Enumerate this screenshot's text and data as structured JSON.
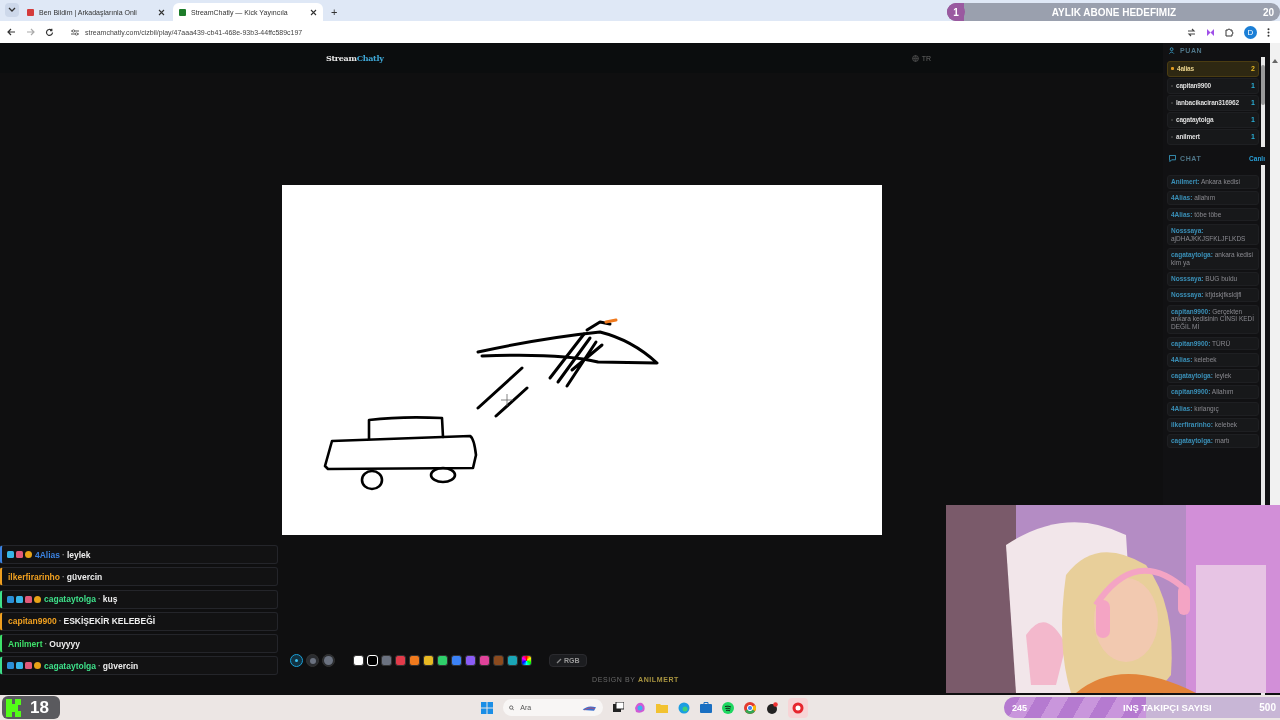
{
  "browser": {
    "tabs": [
      {
        "title": "Ben Bildim | Arkadaşlarınla Onli",
        "selected": false
      },
      {
        "title": "StreamChatly — Kick Yayıncıla",
        "selected": true
      }
    ],
    "new_tab": "+",
    "url": "streamchatly.com/cizbil/play/47aaa439-cb41-468e-93b3-44ffc589c197",
    "profile": "D"
  },
  "goal_overlay": {
    "current": "1",
    "title": "AYLIK ABONE HEDEFIMIZ",
    "target": "20",
    "level": 0.05
  },
  "header": {
    "logo_first": "Stream",
    "logo_second": "Chatly",
    "language": "TR"
  },
  "toolbar": {
    "brush_sizes": [
      {
        "selected": true
      },
      {
        "selected": false
      },
      {
        "selected": false
      }
    ],
    "colors": [
      {
        "kind": "solid",
        "color": "#ffffff",
        "selected": false
      },
      {
        "kind": "solid",
        "color": "#000000",
        "selected": true
      },
      {
        "kind": "solid",
        "color": "#6b7280",
        "selected": false
      },
      {
        "kind": "solid",
        "color": "#e23b4a",
        "selected": false
      },
      {
        "kind": "solid",
        "color": "#f07a1e",
        "selected": false
      },
      {
        "kind": "solid",
        "color": "#e8b923",
        "selected": false
      },
      {
        "kind": "solid",
        "color": "#2fcf6b",
        "selected": false
      },
      {
        "kind": "solid",
        "color": "#3b82f6",
        "selected": false
      },
      {
        "kind": "solid",
        "color": "#8b5cf6",
        "selected": false
      },
      {
        "kind": "solid",
        "color": "#e0439a",
        "selected": false
      },
      {
        "kind": "solid",
        "color": "#8b4a1e",
        "selected": false
      },
      {
        "kind": "solid",
        "color": "#1aa6b7",
        "selected": false
      },
      {
        "kind": "rainbow",
        "selected": false
      }
    ],
    "rgb_button": "RGB"
  },
  "footer": {
    "prefix": "DESIGN BY",
    "author": "ANILMERT"
  },
  "scoreboard": {
    "title": "PUAN",
    "players": [
      {
        "name": "4alias",
        "score": "2",
        "leader": true
      },
      {
        "name": "capitan9900",
        "score": "1",
        "leader": false
      },
      {
        "name": "lanbacikaciran316962",
        "score": "1",
        "leader": false
      },
      {
        "name": "cagataytolga",
        "score": "1",
        "leader": false
      },
      {
        "name": "anilmert",
        "score": "1",
        "leader": false
      }
    ]
  },
  "chat": {
    "title": "CHAT",
    "status": "Canlı",
    "messages": [
      {
        "user": "Anilmert:",
        "text": "Ankara kedisi"
      },
      {
        "user": "4Alias:",
        "text": "allahım"
      },
      {
        "user": "4Alias:",
        "text": "töbe töbe"
      },
      {
        "user": "Nosssaya:",
        "text": "ajDHAJKKJSFKLJFLKDS"
      },
      {
        "user": "cagataytolga:",
        "text": "ankara kedisi kim ya"
      },
      {
        "user": "Nosssaya:",
        "text": "BUG buldu"
      },
      {
        "user": "Nosssaya:",
        "text": "kfjdskjfksldjfl"
      },
      {
        "user": "capitan9900:",
        "text": "Gerçekten ankara kedisinin CİNSİ KEDİ DEĞİL Mİ"
      },
      {
        "user": "capitan9900:",
        "text": "TÜRÜ"
      },
      {
        "user": "4Alias:",
        "text": "kelebek"
      },
      {
        "user": "cagataytolga:",
        "text": "leylek"
      },
      {
        "user": "capitan9900:",
        "text": "Allahım"
      },
      {
        "user": "4Alias:",
        "text": "kırlangıç"
      },
      {
        "user": "ilkerfirarinho:",
        "text": "kelebek"
      },
      {
        "user": "cagataytolga:",
        "text": "martı"
      }
    ]
  },
  "stream_chat": [
    {
      "user": "4Alias",
      "separator": "·",
      "text": "leylek",
      "color": "#3b82e0",
      "badges": [
        {
          "kind": "cube"
        },
        {
          "kind": "gift"
        },
        {
          "kind": "coin"
        }
      ]
    },
    {
      "user": "ilkerfirarinho",
      "separator": "·",
      "text": "güvercin",
      "color": "#f0a020"
    },
    {
      "user": "cagataytolga",
      "separator": "·",
      "text": "kuş",
      "color": "#3ee08a",
      "badges": [
        {
          "kind": "boost"
        },
        {
          "kind": "cube"
        },
        {
          "kind": "gift"
        },
        {
          "kind": "coin"
        }
      ]
    },
    {
      "user": "capitan9900",
      "separator": "·",
      "text": "ESKİŞEKİR KELEBEĞİ",
      "color": "#f0a020"
    },
    {
      "user": "Anilmert",
      "separator": "·",
      "text": "Ouyyyy",
      "color": "#3ee06a"
    },
    {
      "user": "cagataytolga",
      "separator": "·",
      "text": "güvercin",
      "color": "#3ee08a",
      "badges": [
        {
          "kind": "boost"
        },
        {
          "kind": "cube"
        },
        {
          "kind": "gift"
        },
        {
          "kind": "coin"
        }
      ]
    }
  ],
  "taskbar": {
    "kick_count": "18",
    "search_placeholder": "Ara"
  },
  "follower_overlay": {
    "current": "245",
    "title": "INŞ TAKIPÇI SAYISI",
    "target": "500",
    "level": 0.49
  }
}
